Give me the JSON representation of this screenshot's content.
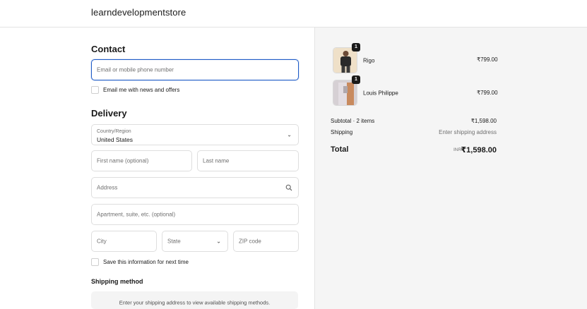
{
  "header": {
    "store_name": "learndevelopmentstore"
  },
  "contact": {
    "heading": "Contact",
    "email_placeholder": "Email or mobile phone number",
    "news_label": "Email me with news and offers"
  },
  "delivery": {
    "heading": "Delivery",
    "country_label": "Country/Region",
    "country_value": "United States",
    "first_name_placeholder": "First name (optional)",
    "last_name_placeholder": "Last name",
    "address_placeholder": "Address",
    "apartment_placeholder": "Apartment, suite, etc. (optional)",
    "city_placeholder": "City",
    "state_placeholder": "State",
    "zip_placeholder": "ZIP code",
    "save_label": "Save this information for next time"
  },
  "shipping_method": {
    "heading": "Shipping method",
    "notice": "Enter your shipping address to view available shipping methods."
  },
  "order": {
    "items": [
      {
        "name": "Rigo",
        "quantity": "1",
        "price": "₹799.00"
      },
      {
        "name": "Louis Philippe",
        "quantity": "1",
        "price": "₹799.00"
      }
    ],
    "subtotal_label": "Subtotal · 2 items",
    "subtotal_value": "₹1,598.00",
    "shipping_label": "Shipping",
    "shipping_value": "Enter shipping address",
    "total_label": "Total",
    "currency": "INR",
    "total_value": "₹1,598.00"
  },
  "colors": {
    "focus": "#1f5cc7",
    "summary_bg": "#f5f5f5"
  }
}
